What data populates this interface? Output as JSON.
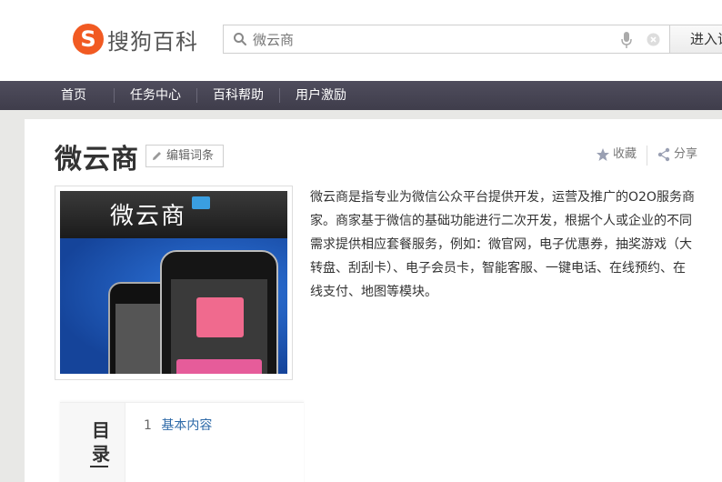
{
  "brand": {
    "name": "搜狗百科",
    "logo_letter": "S",
    "accent_color": "#f15a22"
  },
  "search": {
    "value": "微云商",
    "placeholder": "微云商",
    "enter_label": "进入词"
  },
  "nav": {
    "items": [
      {
        "label": "首页"
      },
      {
        "label": "任务中心"
      },
      {
        "label": "百科帮助"
      },
      {
        "label": "用户激励"
      }
    ],
    "background": "#45434f"
  },
  "entry": {
    "title": "微云商",
    "edit_label": "编辑词条",
    "favorite_label": "收藏",
    "share_label": "分享",
    "image_title": "微云商",
    "description": "微云商是指专业为微信公众平台提供开发，运营及推广的O2O服务商家。商家基于微信的基础功能进行二次开发，根据个人或企业的不同需求提供相应套餐服务，例如：微官网，电子优惠券，抽奖游戏（大转盘、刮刮卡）、电子会员卡，智能客服、一键电话、在线预约、在线支付、地图等模块。"
  },
  "toc": {
    "label": "目录",
    "items": [
      {
        "number": "1",
        "label": "基本内容"
      }
    ]
  },
  "icons": [
    "search-icon",
    "mic-icon",
    "clear-icon",
    "edit-icon",
    "star-icon",
    "share-icon"
  ]
}
